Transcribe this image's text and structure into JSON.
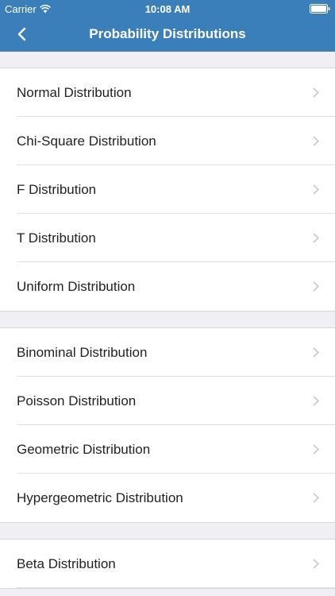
{
  "status_bar": {
    "carrier": "Carrier",
    "time": "10:08 AM"
  },
  "nav": {
    "title": "Probability Distributions",
    "back_icon": "chevron-left-icon"
  },
  "colors": {
    "accent": "#3a7fb9",
    "background": "#efeff4",
    "chevron": "#c7c7cc"
  },
  "sections": [
    {
      "items": [
        {
          "label": "Normal Distribution"
        },
        {
          "label": "Chi-Square Distribution"
        },
        {
          "label": "F Distribution"
        },
        {
          "label": "T Distribution"
        },
        {
          "label": "Uniform Distribution"
        }
      ]
    },
    {
      "items": [
        {
          "label": "Binominal Distribution"
        },
        {
          "label": "Poisson Distribution"
        },
        {
          "label": "Geometric Distribution"
        },
        {
          "label": "Hypergeometric Distribution"
        }
      ]
    },
    {
      "items": [
        {
          "label": "Beta Distribution"
        }
      ]
    }
  ]
}
